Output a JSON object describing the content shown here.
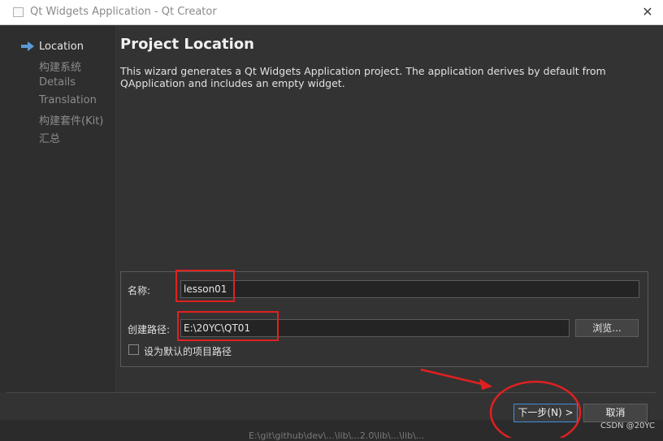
{
  "window": {
    "title": "Qt Widgets Application - Qt Creator",
    "close_glyph": "✕"
  },
  "steps": [
    {
      "label": "Location",
      "active": true
    },
    {
      "label": "构建系统",
      "active": false
    },
    {
      "label": "Details",
      "active": false
    },
    {
      "label": "Translation",
      "active": false
    },
    {
      "label": "构建套件(Kit)",
      "active": false
    },
    {
      "label": "汇总",
      "active": false
    }
  ],
  "page": {
    "title": "Project Location",
    "description": "This wizard generates a Qt Widgets Application project. The application derives by default from QApplication and includes an empty widget."
  },
  "form": {
    "name_label": "名称:",
    "name_value": "lesson01",
    "path_label": "创建路径:",
    "path_value": "E:\\20YC\\QT01",
    "browse_label": "浏览...",
    "default_checkbox_label": "设为默认的项目路径",
    "default_checked": false
  },
  "buttons": {
    "next_label": "下一步(N) >",
    "cancel_label": "取消"
  },
  "background_text": "E:\\git\\github\\dev\\...\\lib\\...2.0\\lib\\...\\lib\\...",
  "watermark": "CSDN @20YC",
  "colors": {
    "annotation": "#e02020",
    "accent_arrow": "#5b9bd5",
    "focus_border": "#3e8ede"
  },
  "icons": {
    "active_step": "arrow-right-icon",
    "window": "window-icon",
    "close": "close-icon"
  }
}
